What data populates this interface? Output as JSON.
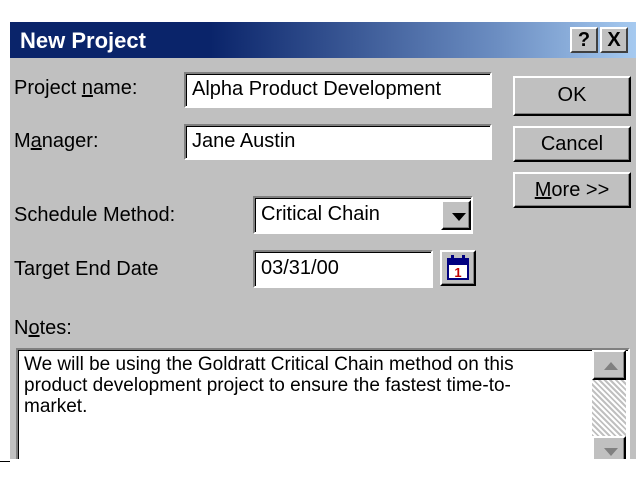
{
  "dialog": {
    "title": "New Project",
    "help_button": "?",
    "close_button": "X",
    "fields": {
      "project_name": {
        "label_pre": "Project ",
        "label_key": "n",
        "label_post": "ame:",
        "value": "Alpha Product Development"
      },
      "manager": {
        "label_pre": "M",
        "label_key": "a",
        "label_post": "nager:",
        "value": "Jane Austin"
      },
      "schedule_method": {
        "label": "Schedule Method:",
        "value": "Critical Chain"
      },
      "target_end_date": {
        "label": "Target End Date",
        "value": "03/31/00"
      },
      "notes": {
        "label_pre": "N",
        "label_key": "o",
        "label_post": "tes:",
        "value": "We will be using the Goldratt Critical Chain method on this product development project to ensure the fastest time-to-market."
      }
    },
    "buttons": {
      "ok": "OK",
      "cancel": "Cancel",
      "more_key": "M",
      "more_rest": "ore >>"
    },
    "calendar_icon_text": "1"
  }
}
